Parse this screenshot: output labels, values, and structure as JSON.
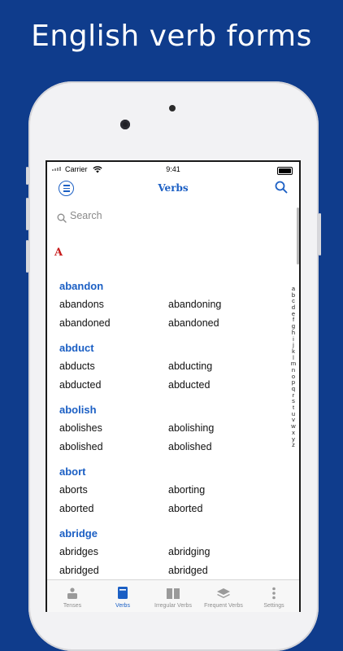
{
  "headline": "English verb forms",
  "status": {
    "carrier": "Carrier",
    "time": "9:41"
  },
  "nav": {
    "title": "Verbs"
  },
  "search": {
    "placeholder": "Search"
  },
  "section": {
    "letter": "A"
  },
  "verbs": [
    {
      "title": "abandon",
      "forms": [
        "abandons",
        "abandoning",
        "abandoned",
        "abandoned"
      ]
    },
    {
      "title": "abduct",
      "forms": [
        "abducts",
        "abducting",
        "abducted",
        "abducted"
      ]
    },
    {
      "title": "abolish",
      "forms": [
        "abolishes",
        "abolishing",
        "abolished",
        "abolished"
      ]
    },
    {
      "title": "abort",
      "forms": [
        "aborts",
        "aborting",
        "aborted",
        "aborted"
      ]
    },
    {
      "title": "abridge",
      "forms": [
        "abridges",
        "abridging",
        "abridged",
        "abridged"
      ]
    }
  ],
  "index": [
    "a",
    "b",
    "c",
    "d",
    "e",
    "f",
    "g",
    "h",
    "i",
    "j",
    "k",
    "l",
    "m",
    "n",
    "o",
    "p",
    "q",
    "r",
    "s",
    "t",
    "u",
    "v",
    "w",
    "x",
    "y",
    "z"
  ],
  "tabs": [
    {
      "label": "Tenses",
      "icon": "tenses-icon"
    },
    {
      "label": "Verbs",
      "icon": "book-icon"
    },
    {
      "label": "Irregular Verbs",
      "icon": "open-book-icon"
    },
    {
      "label": "Frequent Verbs",
      "icon": "layers-icon"
    },
    {
      "label": "Settings",
      "icon": "more-dots-icon"
    }
  ],
  "colors": {
    "background": "#0f3c8c",
    "accent": "#1b5fc4",
    "section_letter": "#c71c1c",
    "tab_inactive": "#8e8e8e"
  }
}
